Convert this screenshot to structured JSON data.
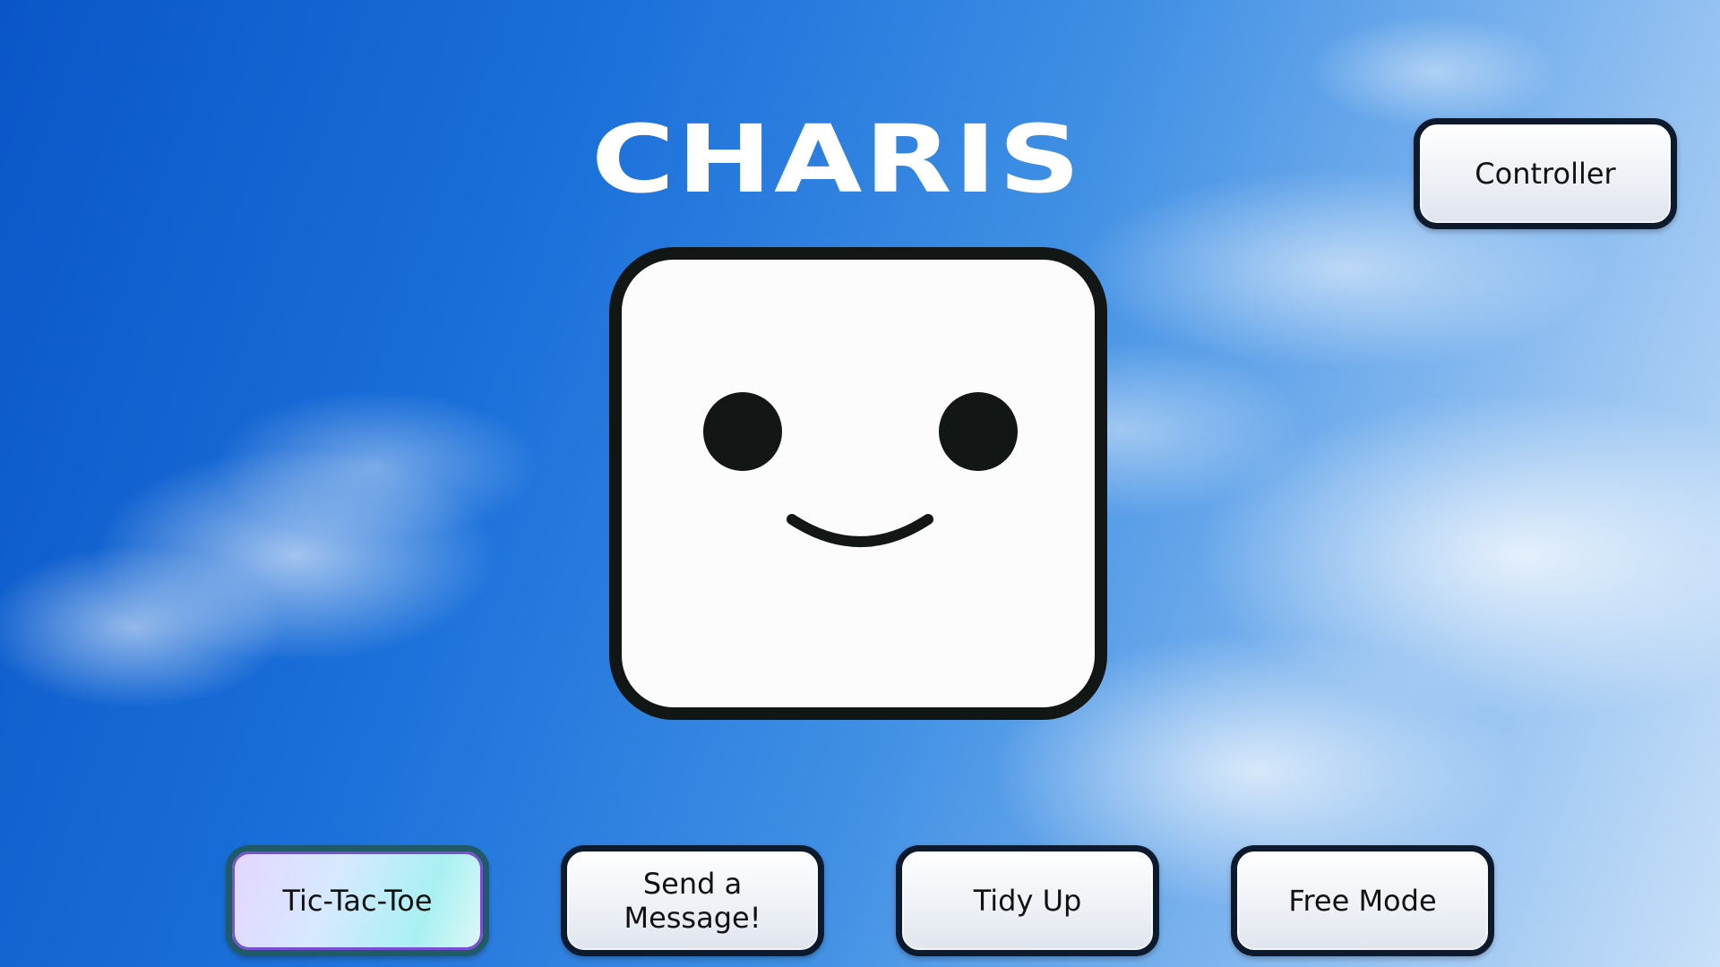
{
  "app": {
    "title": "CHARIS"
  },
  "face": {
    "expression": "smile",
    "icon": "smiley-face-icon",
    "colors": {
      "fill": "#fdfcfc",
      "outline": "#121716"
    }
  },
  "header_buttons": {
    "controller_label": "Controller"
  },
  "mode_buttons": [
    {
      "label": "Tic-Tac-Toe",
      "selected": true
    },
    {
      "label": "Send a Message!",
      "selected": false
    },
    {
      "label": "Tidy Up",
      "selected": false
    },
    {
      "label": "Free Mode",
      "selected": false
    }
  ],
  "colors": {
    "title_text": "#ffffff",
    "button_border": "#0d1a2e",
    "sky_top": "#0a56c8",
    "sky_light": "#c9e0f8",
    "selected_accent": "#7a4fd6"
  }
}
